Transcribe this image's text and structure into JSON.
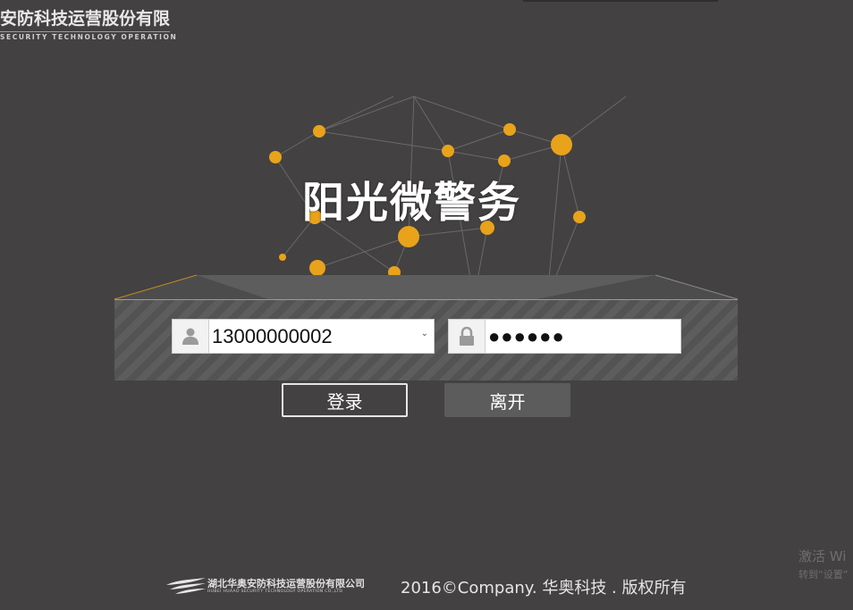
{
  "brand": {
    "company_cn": "安防科技运营股份有限",
    "company_en": "SECURITY TECHNOLOGY OPERATION"
  },
  "app_title": "阳光微警务",
  "login": {
    "username_value": "13000000002",
    "password_value": "●●●●●●",
    "login_button": "登录",
    "exit_button": "离开"
  },
  "footer": {
    "logo_cn": "湖北华奥安防科技运营股份有限公司",
    "logo_en": "HUBEI HUAAO SECURITY TECHNOLOGY OPERATION CO.,LTD",
    "copyright": "2016©Company. 华奥科技 . 版权所有"
  },
  "watermark": {
    "line1": "激活 Wi",
    "line2": "转到“设置”"
  },
  "colors": {
    "background": "#434142",
    "node": "#e8a31a",
    "panel": "#5a595a"
  },
  "icons": {
    "user": "user-icon",
    "lock": "lock-icon",
    "dropdown": "chevron-down-icon"
  }
}
